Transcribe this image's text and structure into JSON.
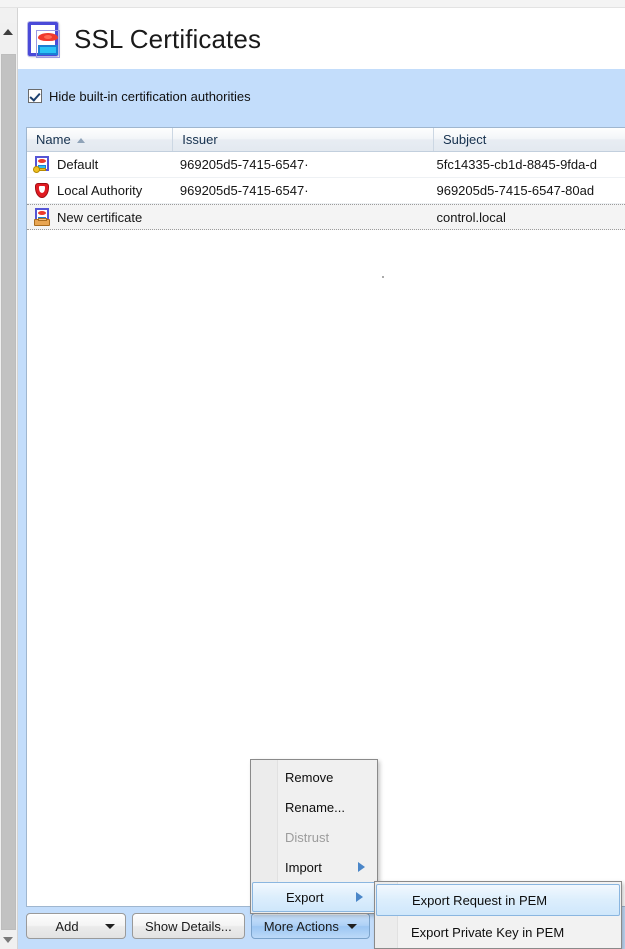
{
  "window": {
    "title": "SSL Certificates",
    "header_icon": "certificate-icon"
  },
  "options": {
    "hide_builtin_label": "Hide built-in certification authorities",
    "hide_builtin_checked": true
  },
  "table": {
    "columns": [
      {
        "key": "name",
        "label": "Name",
        "sorted": "asc",
        "sort_glyph": "sort-ascending-icon"
      },
      {
        "key": "issuer",
        "label": "Issuer",
        "sorted": ""
      },
      {
        "key": "subject",
        "label": "Subject",
        "sorted": ""
      }
    ],
    "rows": [
      {
        "icon": "certificate-with-key-icon",
        "name": "Default",
        "issuer": "969205d5-7415-6547·",
        "subject": "5fc14335-cb1d-8845-9fda-d",
        "selected": false
      },
      {
        "icon": "red-shield-icon",
        "name": "Local Authority",
        "issuer": "969205d5-7415-6547·",
        "subject": "969205d5-7415-6547-80ad",
        "selected": false
      },
      {
        "icon": "certificate-request-icon",
        "name": "New certificate",
        "issuer": "",
        "subject": "control.local",
        "selected": true
      }
    ]
  },
  "buttons": {
    "add": "Add",
    "add_caret": "caret-down-icon",
    "show_details": "Show Details...",
    "more_actions": "More Actions",
    "more_actions_caret": "caret-down-icon",
    "more_actions_active": true
  },
  "menu": {
    "items": [
      {
        "label": "Remove",
        "disabled": false,
        "submenu": false,
        "hover": false
      },
      {
        "label": "Rename...",
        "disabled": false,
        "submenu": false,
        "hover": false
      },
      {
        "label": "Distrust",
        "disabled": true,
        "submenu": false,
        "hover": false
      },
      {
        "label": "Import",
        "disabled": false,
        "submenu": true,
        "hover": false
      },
      {
        "label": "Export",
        "disabled": false,
        "submenu": true,
        "hover": true
      }
    ],
    "submenu": {
      "items": [
        {
          "label": "Export Request in PEM",
          "hover": true
        },
        {
          "label": "Export Private Key in PEM",
          "hover": false
        }
      ]
    }
  },
  "colors": {
    "panel_blue": "#c3ddfb",
    "accent_blue": "#4a86c8",
    "selection_blue": "#cfe7fb",
    "shield_red": "#e11b22",
    "key_gold": "#f0c020"
  }
}
